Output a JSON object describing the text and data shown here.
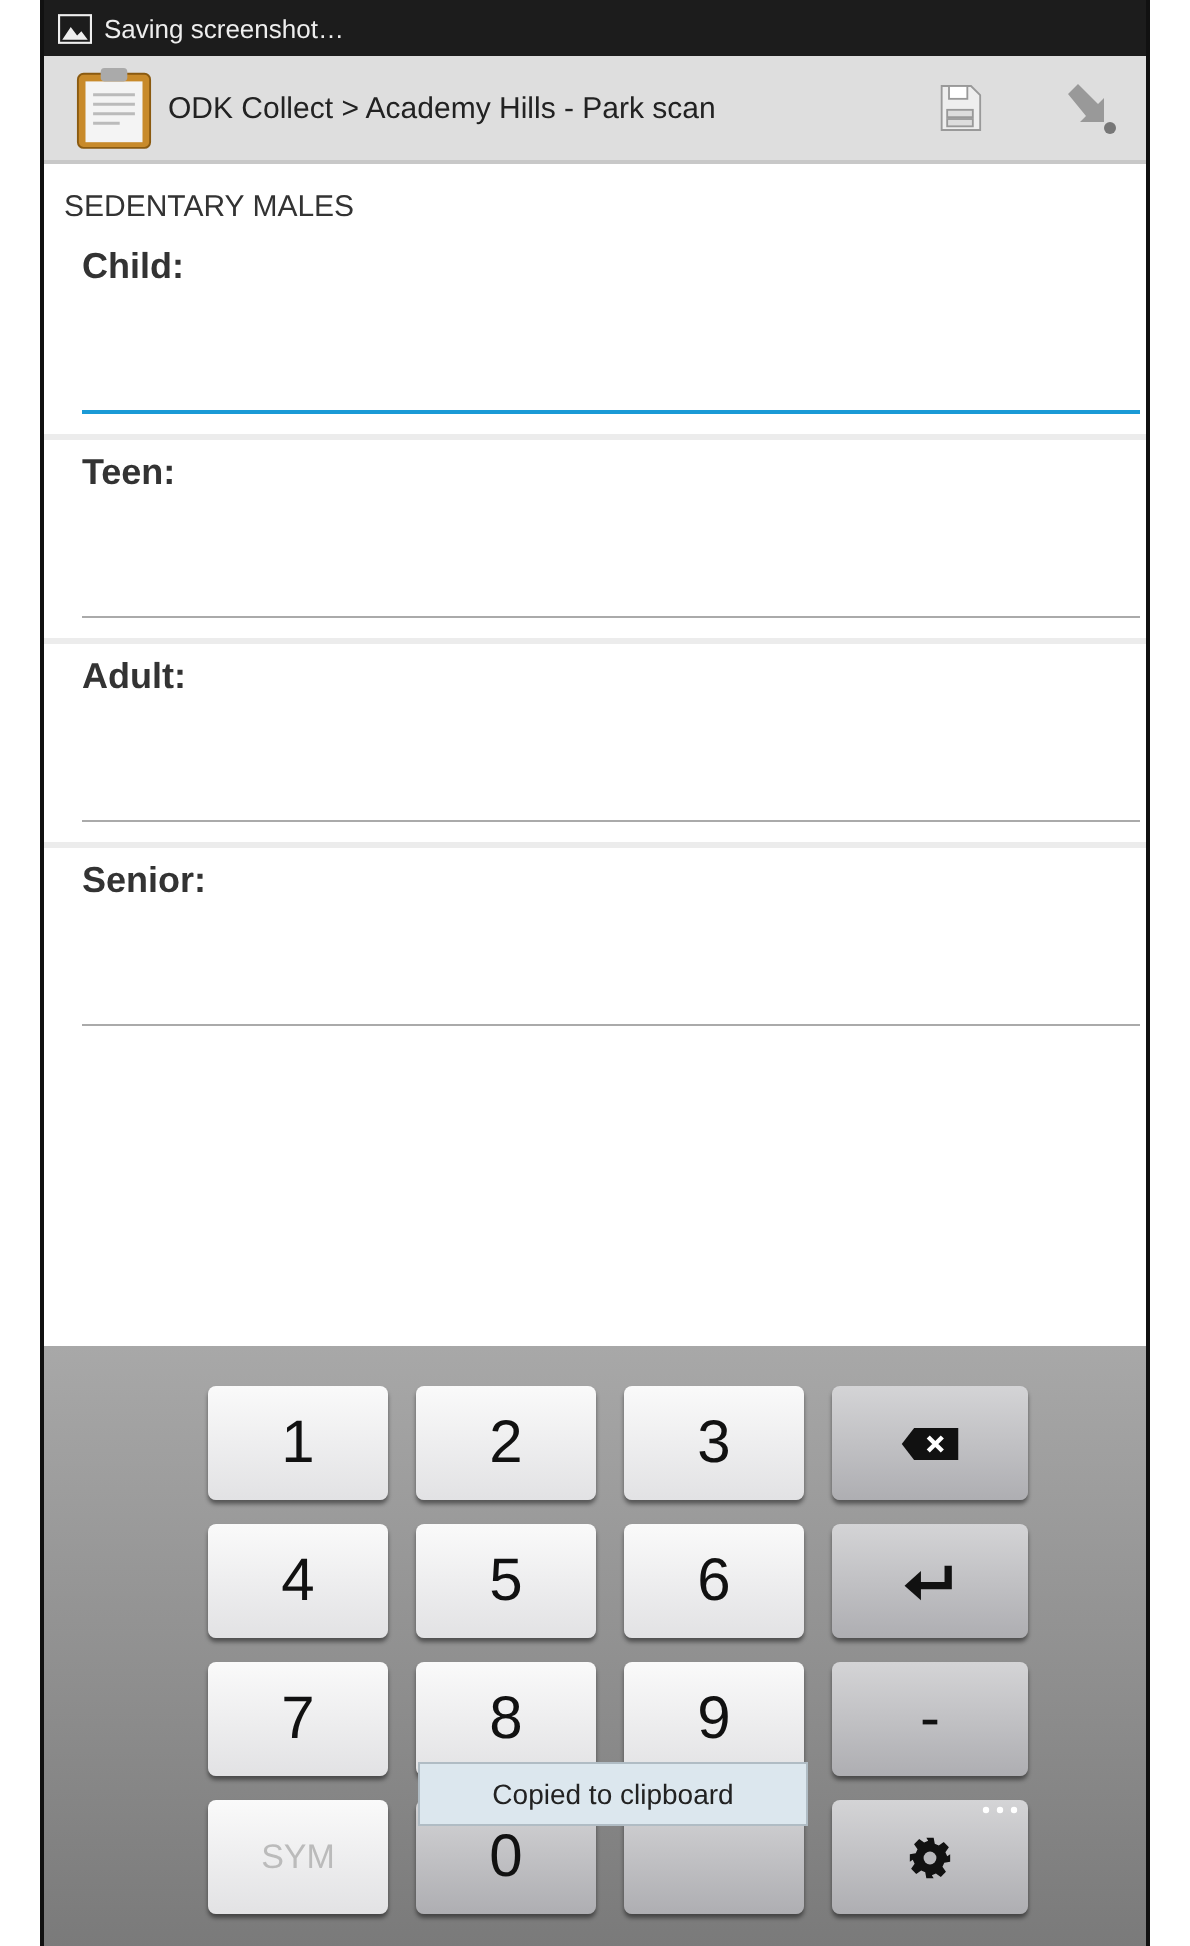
{
  "status_bar": {
    "notification": "Saving screenshot…"
  },
  "action_bar": {
    "title": "ODK Collect > Academy Hills - Park scan"
  },
  "group_title": "SEDENTARY MALES",
  "questions": [
    {
      "label": "Child:",
      "focused": true
    },
    {
      "label": "Teen:",
      "focused": false
    },
    {
      "label": "Adult:",
      "focused": false
    },
    {
      "label": "Senior:",
      "focused": false
    }
  ],
  "keyboard": {
    "keys": [
      {
        "kind": "char",
        "label": "1"
      },
      {
        "kind": "char",
        "label": "2"
      },
      {
        "kind": "char",
        "label": "3"
      },
      {
        "kind": "backspace"
      },
      {
        "kind": "char",
        "label": "4"
      },
      {
        "kind": "char",
        "label": "5"
      },
      {
        "kind": "char",
        "label": "6"
      },
      {
        "kind": "enter"
      },
      {
        "kind": "char",
        "label": "7"
      },
      {
        "kind": "char",
        "label": "8"
      },
      {
        "kind": "char",
        "label": "9"
      },
      {
        "kind": "function",
        "label": "-"
      },
      {
        "kind": "sym",
        "label": "SYM"
      },
      {
        "kind": "function",
        "label": "0"
      },
      {
        "kind": "blank"
      },
      {
        "kind": "settings"
      }
    ]
  },
  "toast": "Copied to clipboard"
}
